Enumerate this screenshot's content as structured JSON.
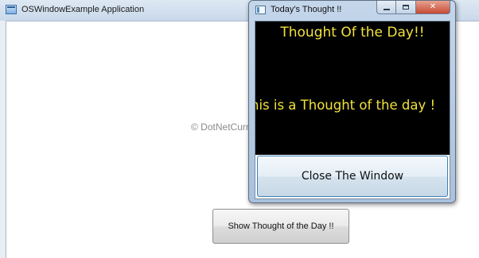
{
  "main_window": {
    "title": "OSWindowExample Application",
    "watermark": "© DotNetCurry.com",
    "show_button_label": "Show Thought of the Day !!"
  },
  "popup": {
    "title": "Today's Thought !!",
    "heading": "Thought Of the Day!!",
    "thought": "his is a Thought of the day !",
    "close_button_label": "Close The Window",
    "close_glyph": "✕"
  },
  "colors": {
    "thought_text": "#f2e23c",
    "panel_background": "#000000"
  },
  "icons": [
    "window-app-icon",
    "minimize-icon",
    "maximize-icon",
    "close-icon"
  ]
}
